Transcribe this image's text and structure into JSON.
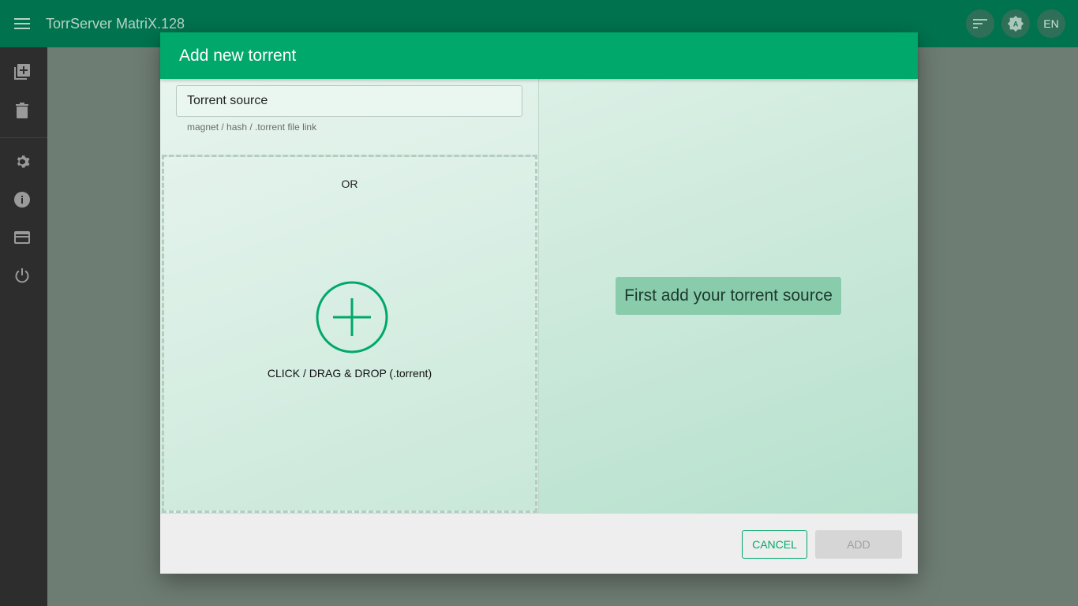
{
  "app": {
    "title": "TorrServer MatriX.128",
    "lang_button": "EN",
    "accent": "#00a86b",
    "appbar_color": "#00734e"
  },
  "appbar_icons": [
    "sort-icon",
    "auto-theme-icon"
  ],
  "sidebar": {
    "items": [
      {
        "icon": "add-library-icon"
      },
      {
        "icon": "trash-icon"
      },
      {
        "icon": "settings-icon"
      },
      {
        "icon": "info-icon"
      },
      {
        "icon": "card-icon"
      },
      {
        "icon": "power-icon"
      }
    ]
  },
  "dialog": {
    "title": "Add new torrent",
    "source_placeholder": "Torrent source",
    "source_value": "",
    "helper": "magnet / hash / .torrent file link",
    "or_text": "OR",
    "drop_label": "CLICK / DRAG & DROP (.torrent)",
    "hint": "First add your torrent source",
    "cancel_label": "CANCEL",
    "add_label": "ADD"
  }
}
